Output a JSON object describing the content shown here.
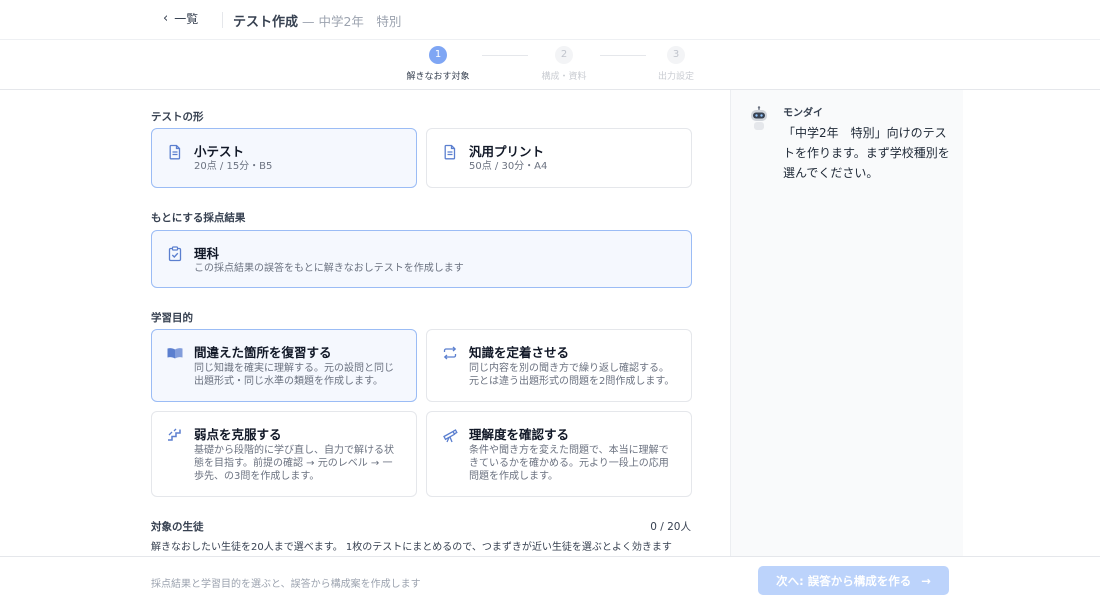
{
  "header": {
    "back_label": "一覧",
    "title": "テスト作成",
    "subtitle": "— 中学2年　特別"
  },
  "stepper": {
    "steps": [
      {
        "number": "1",
        "label": "解きなおす対象"
      },
      {
        "number": "2",
        "label": "構成・資料"
      },
      {
        "number": "3",
        "label": "出力設定"
      }
    ],
    "current": 1
  },
  "test_form": {
    "label": "テストの形",
    "options": [
      {
        "title": "小テスト",
        "spec": "20点 / 15分・B5",
        "icon": "document-icon"
      },
      {
        "title": "汎用プリント",
        "spec": "50点 / 30分・A4",
        "icon": "document-icon"
      }
    ]
  },
  "source": {
    "label": "もとにする採点結果",
    "item": {
      "title": "理科",
      "desc": "この採点結果の誤答をもとに解きなおしテストを作成します",
      "icon": "clipboard-check-icon"
    }
  },
  "purpose": {
    "label": "学習目的",
    "options": [
      {
        "title": "間違えた箇所を復習する",
        "desc": "同じ知識を確実に理解する。元の設問と同じ出題形式・同じ水準の類題を作成します。",
        "icon": "book-icon"
      },
      {
        "title": "知識を定着させる",
        "desc": "同じ内容を別の聞き方で繰り返し確認する。元とは違う出題形式の問題を2問作成します。",
        "icon": "repeat-icon"
      },
      {
        "title": "弱点を克服する",
        "desc": "基礎から段階的に学び直し、自力で解ける状態を目指す。前提の確認 → 元のレベル → 一歩先、の3問を作成します。",
        "icon": "stairs-icon"
      },
      {
        "title": "理解度を確認する",
        "desc": "条件や聞き方を変えた問題で、本当に理解できているかを確かめる。元より一段上の応用問題を作成します。",
        "icon": "telescope-icon"
      }
    ]
  },
  "students": {
    "label": "対象の生徒",
    "count": "0 / 20人",
    "hint": "解きなおしたい生徒を20人まで選べます。 1枚のテストにまとめるので、つまずきが近い生徒を選ぶとよく効きます"
  },
  "assistant": {
    "name": "モンダイ",
    "message": "「中学2年　特別」向けのテストを作ります。まず学校種別を選んでください。"
  },
  "footer": {
    "hint": "採点結果と学習目的を選ぶと、誤答から構成案を作成します",
    "next_label": "次へ: 誤答から構成を作る",
    "next_arrow": "→"
  },
  "colors": {
    "accent": "#7fa6f4",
    "selected_border": "#9bbcf5",
    "selected_bg": "#f5f8fe",
    "button_disabled": "#bcd3fb"
  }
}
